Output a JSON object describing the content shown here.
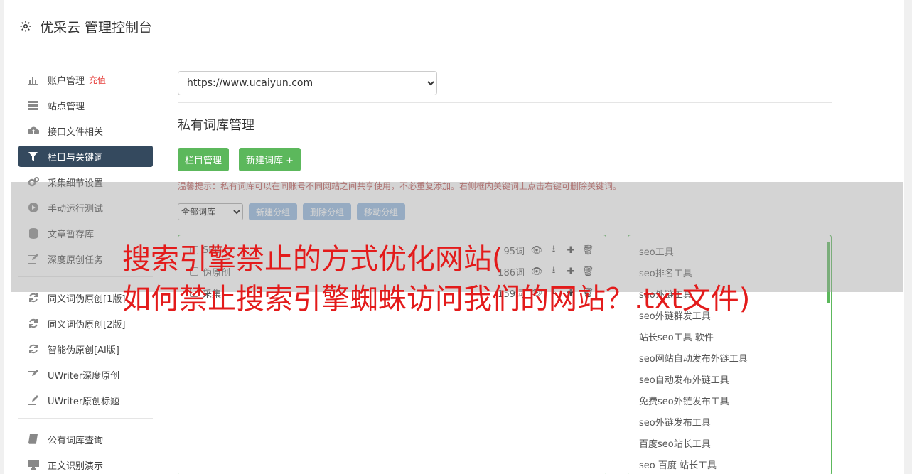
{
  "header": {
    "title": "优采云 管理控制台"
  },
  "sidebar": {
    "items": [
      {
        "label": "账户管理",
        "icon": "bar-chart-icon",
        "badge": "充值"
      },
      {
        "label": "站点管理",
        "icon": "server-icon"
      },
      {
        "label": "接口文件相关",
        "icon": "cloud-upload-icon"
      },
      {
        "label": "栏目与关键词",
        "icon": "filter-icon",
        "active": true
      },
      {
        "label": "采集细节设置",
        "icon": "gears-icon"
      },
      {
        "label": "手动运行测试",
        "icon": "play-circle-icon"
      },
      {
        "label": "文章暂存库",
        "icon": "database-icon"
      },
      {
        "label": "深度原创任务",
        "icon": "edit-icon"
      },
      {
        "label": "同义词伪原创[1版]",
        "icon": "refresh-icon"
      },
      {
        "label": "同义词伪原创[2版]",
        "icon": "refresh-icon"
      },
      {
        "label": "智能伪原创[AI版]",
        "icon": "refresh-icon"
      },
      {
        "label": "UWriter深度原创",
        "icon": "edit-icon"
      },
      {
        "label": "UWriter原创标题",
        "icon": "edit-icon"
      },
      {
        "label": "公有词库查询",
        "icon": "book-icon"
      },
      {
        "label": "正文识别演示",
        "icon": "monitor-icon"
      }
    ]
  },
  "main": {
    "site_select": "https://www.ucaiyun.com",
    "section_title": "私有词库管理",
    "btn_columns": "栏目管理",
    "btn_new_lib": "新建词库 +",
    "tip": "温馨提示：私有词库可以在同账号不同网站之间共享使用，不必重复添加。右侧框内关键词上点击右键可删除关键词。",
    "lib_filter": "全部词库",
    "btn_new_group": "新建分组",
    "btn_del_group": "删除分组",
    "btn_move_group": "移动分组",
    "libraries": [
      {
        "name": "SEO",
        "count": "95词"
      },
      {
        "name": "伪原创",
        "count": "186词"
      },
      {
        "name": "采集",
        "count": "159词"
      }
    ],
    "keywords": [
      "seo工具",
      "seo排名工具",
      "seo外链工具",
      "seo外链群发工具",
      "站长seo工具 软件",
      "seo网站自动发布外链工具",
      "seo自动发布外链工具",
      "免费seo外链发布工具",
      "seo外链发布工具",
      "百度seo站长工具",
      "seo 百度 站长工具"
    ]
  },
  "overlay": {
    "line1": "搜索引擎禁止的方式优化网站(",
    "line2": "如何禁止搜索引擎蜘蛛访问我们的网站？.txt文件)"
  },
  "colors": {
    "accent_green": "#5cb85c",
    "nav_active": "#34495e",
    "headline_red": "#e31b1b",
    "tip_red": "#b94a48",
    "btn_blue": "#8fb5de"
  }
}
